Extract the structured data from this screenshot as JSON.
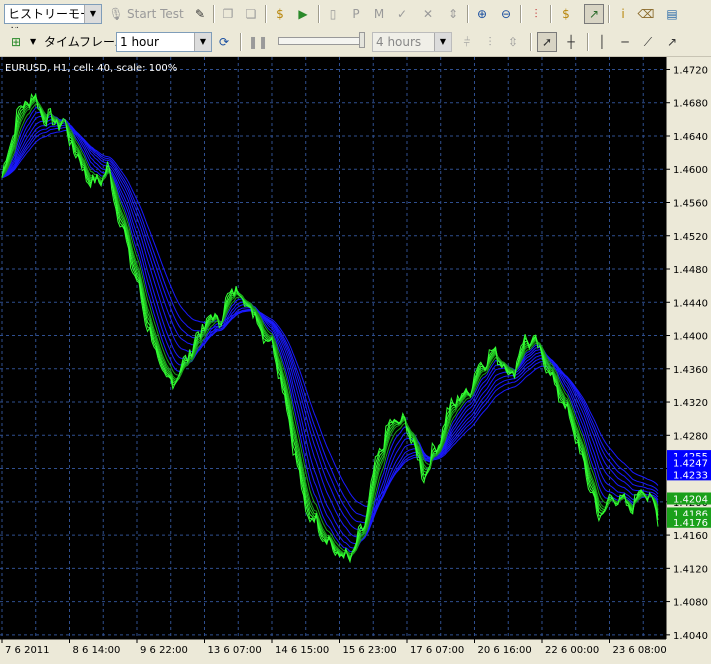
{
  "toolbar_top": {
    "mode_select": "ヒストリーモード",
    "start_test_label": "Start Test"
  },
  "toolbar_second": {
    "timeframe_label": "タイムフレーム:",
    "timeframe_select": "1 hour",
    "interval_select": "4 hours"
  },
  "chart": {
    "info_label": "EURUSD, H1, cell: 40, scale: 100%",
    "y_ticks": [
      "1.4720",
      "1.4680",
      "1.4640",
      "1.4600",
      "1.4560",
      "1.4520",
      "1.4480",
      "1.4440",
      "1.4400",
      "1.4360",
      "1.4320",
      "1.4280",
      "1.4240",
      "1.4200",
      "1.4160",
      "1.4120",
      "1.4080",
      "1.4040"
    ],
    "x_ticks": [
      "7 6 2011",
      "8 6 14:00",
      "9 6 22:00",
      "13 6 07:00",
      "14 6 15:00",
      "15 6 23:00",
      "17 6 07:00",
      "20 6 16:00",
      "22 6 00:00",
      "23 6 08:00"
    ],
    "price_labels": [
      {
        "text": "1.4255",
        "value": 1.4255,
        "color": "#0000ff"
      },
      {
        "text": "1.4247",
        "value": 1.4247,
        "color": "#0000ff"
      },
      {
        "text": "1.4233",
        "value": 1.4233,
        "color": "#0000ff"
      },
      {
        "text": "1.4204",
        "value": 1.4204,
        "color": "#1aa01a"
      },
      {
        "text": "1.4186",
        "value": 1.4186,
        "color": "#1aa01a"
      },
      {
        "text": "1.4176",
        "value": 1.4176,
        "color": "#1aa01a"
      }
    ],
    "colors": {
      "background": "#000000",
      "grid": "#2f4f8f",
      "fast": "#33ff33",
      "slow": "#1a1aff"
    }
  },
  "chart_data": {
    "type": "line",
    "title": "EURUSD, H1, cell: 40, scale: 100%",
    "xlabel": "",
    "ylabel": "",
    "ylim": [
      1.4035,
      1.4735
    ],
    "x_tick_labels": [
      "7 6 2011",
      "8 6 14:00",
      "9 6 22:00",
      "13 6 07:00",
      "14 6 15:00",
      "15 6 23:00",
      "17 6 07:00",
      "20 6 16:00",
      "22 6 00:00",
      "23 6 08:00"
    ],
    "bars_per_tick": 32,
    "bars": 312,
    "price_key_points": [
      [
        0,
        1.459
      ],
      [
        10,
        1.4665
      ],
      [
        20,
        1.469
      ],
      [
        30,
        1.466
      ],
      [
        42,
        1.4655
      ],
      [
        52,
        1.461
      ],
      [
        62,
        1.458
      ],
      [
        72,
        1.46
      ],
      [
        80,
        1.454
      ],
      [
        92,
        1.446
      ],
      [
        104,
        1.438
      ],
      [
        112,
        1.434
      ],
      [
        122,
        1.436
      ],
      [
        130,
        1.439
      ],
      [
        140,
        1.442
      ],
      [
        148,
        1.442
      ],
      [
        158,
        1.446
      ],
      [
        166,
        1.444
      ],
      [
        176,
        1.441
      ],
      [
        186,
        1.438
      ],
      [
        196,
        1.429
      ],
      [
        206,
        1.419
      ],
      [
        216,
        1.417
      ],
      [
        226,
        1.414
      ],
      [
        236,
        1.413
      ],
      [
        246,
        1.417
      ],
      [
        256,
        1.426
      ],
      [
        266,
        1.43
      ],
      [
        276,
        1.429
      ],
      [
        286,
        1.423
      ],
      [
        296,
        1.427
      ],
      [
        306,
        1.432
      ],
      [
        316,
        1.433
      ],
      [
        326,
        1.437
      ],
      [
        336,
        1.438
      ],
      [
        346,
        1.435
      ],
      [
        356,
        1.44
      ],
      [
        366,
        1.438
      ],
      [
        376,
        1.434
      ],
      [
        386,
        1.43
      ],
      [
        396,
        1.424
      ],
      [
        406,
        1.418
      ],
      [
        416,
        1.421
      ],
      [
        426,
        1.419
      ],
      [
        436,
        1.422
      ],
      [
        446,
        1.418
      ]
    ],
    "series": [
      {
        "name": "",
        "kind": "fast",
        "periods": [
          2,
          3,
          4,
          5,
          6,
          8
        ]
      },
      {
        "name": "",
        "kind": "slow",
        "periods": [
          10,
          13,
          16,
          20,
          24,
          28,
          32,
          38
        ]
      }
    ]
  }
}
